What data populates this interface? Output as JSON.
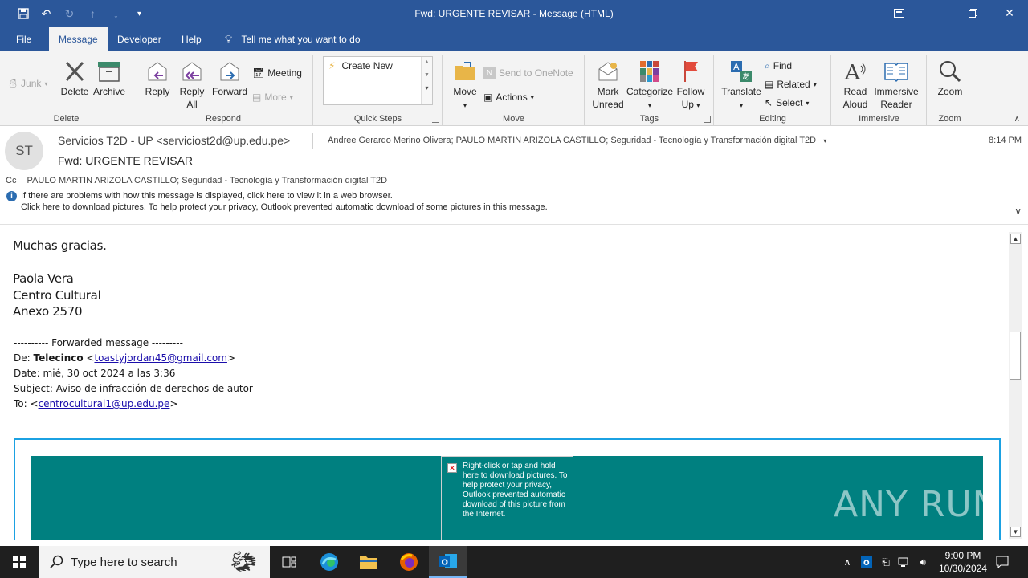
{
  "window": {
    "title": "Fwd: URGENTE REVISAR  -  Message (HTML)"
  },
  "tabs": {
    "file": "File",
    "message": "Message",
    "developer": "Developer",
    "help": "Help",
    "tell_me": "Tell me what you want to do"
  },
  "ribbon": {
    "delete_group": {
      "junk": "Junk",
      "delete": "Delete",
      "archive": "Archive",
      "label": "Delete"
    },
    "respond_group": {
      "reply": "Reply",
      "reply_all_1": "Reply",
      "reply_all_2": "All",
      "forward": "Forward",
      "meeting": "Meeting",
      "more": "More",
      "label": "Respond"
    },
    "quick_steps": {
      "create_new": "Create New",
      "label": "Quick Steps"
    },
    "move_group": {
      "move": "Move",
      "send_onenote": "Send to OneNote",
      "actions": "Actions",
      "label": "Move"
    },
    "tags_group": {
      "mark_unread_1": "Mark",
      "mark_unread_2": "Unread",
      "categorize": "Categorize",
      "follow_up_1": "Follow",
      "follow_up_2": "Up",
      "label": "Tags"
    },
    "editing_group": {
      "translate": "Translate",
      "find": "Find",
      "related": "Related",
      "select": "Select",
      "label": "Editing"
    },
    "immersive_group": {
      "read_aloud_1": "Read",
      "read_aloud_2": "Aloud",
      "immersive_reader_1": "Immersive",
      "immersive_reader_2": "Reader",
      "label": "Immersive"
    },
    "zoom_group": {
      "zoom": "Zoom",
      "label": "Zoom"
    }
  },
  "message": {
    "avatar_initials": "ST",
    "sender": "Servicios T2D - UP <serviciost2d@up.edu.pe>",
    "to": "Andree Gerardo Merino Olivera; PAULO MARTIN ARIZOLA CASTILLO; Seguridad - Tecnología y Transformación digital T2D",
    "time": "8:14 PM",
    "subject": "Fwd: URGENTE REVISAR",
    "cc_label": "Cc",
    "cc": "PAULO MARTIN ARIZOLA CASTILLO; Seguridad - Tecnología y Transformación digital T2D",
    "info_line1": "If there are problems with how this message is displayed, click here to view it in a web browser.",
    "info_line2": "Click here to download pictures. To help protect your privacy, Outlook prevented automatic download of some pictures in this message."
  },
  "body": {
    "thanks": "Muchas gracias.",
    "sig_name": "Paola Vera",
    "sig_dept": "Centro Cultural",
    "sig_ext": "Anexo 2570",
    "fwd_header": "---------- Forwarded message ---------",
    "from_label": "De: ",
    "from_name": "Telecinco",
    "from_email": "toastyjordan45@gmail.com",
    "date_line": "Date: mié, 30 oct 2024  a las 3:36",
    "subject_line": "Subject: Aviso de infracción de derechos de autor",
    "to_label": "To: ",
    "to_email": "centrocultural1@up.edu.pe",
    "blocked_image_text": "Right-click or tap and hold here to download pictures. To help protect your privacy, Outlook prevented automatic download of this picture from the Internet.",
    "watermark": "ANY RUN"
  },
  "taskbar": {
    "search_placeholder": "Type here to search",
    "time": "9:00 PM",
    "date": "10/30/2024"
  },
  "colors": {
    "titlebar": "#2b579a",
    "teal_banner": "#008080",
    "link": "#1a0dab"
  }
}
